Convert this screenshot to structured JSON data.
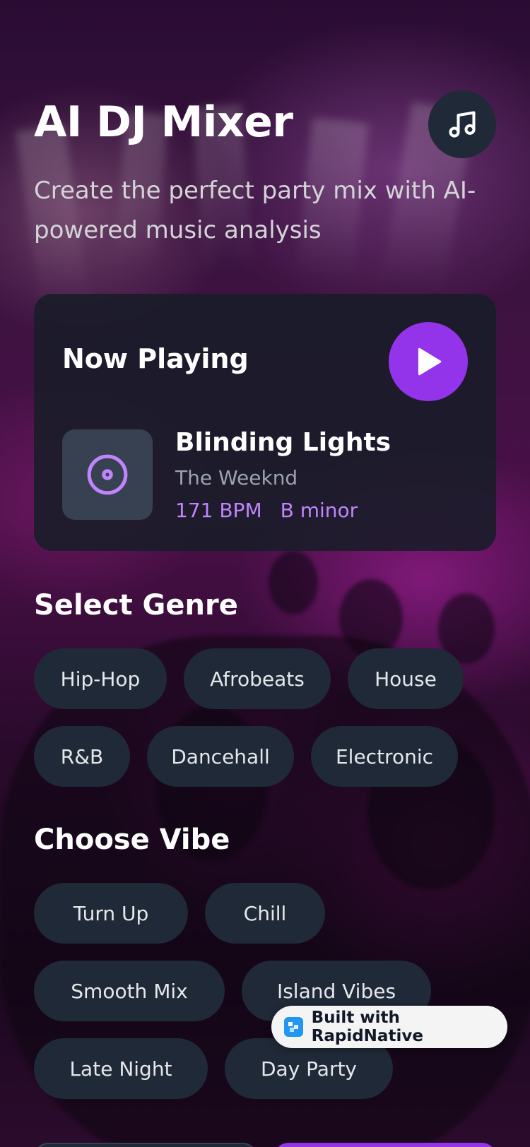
{
  "header": {
    "title": "AI DJ Mixer",
    "subtitle": "Create the perfect party mix with AI-powered music analysis",
    "music_icon": "music-note-icon"
  },
  "now_playing": {
    "heading": "Now Playing",
    "play_icon": "play-icon",
    "art_icon": "disc-icon",
    "track": "Blinding Lights",
    "artist": "The Weeknd",
    "bpm": "171 BPM",
    "key": "B minor"
  },
  "genre": {
    "heading": "Select Genre",
    "options": [
      "Hip-Hop",
      "Afrobeats",
      "House",
      "R&B",
      "Dancehall",
      "Electronic"
    ]
  },
  "vibe": {
    "heading": "Choose Vibe",
    "options": [
      "Turn Up",
      "Chill",
      "Smooth Mix",
      "Island Vibes",
      "Late Night",
      "Day Party"
    ]
  },
  "badge": {
    "label": "Built with RapidNative"
  },
  "colors": {
    "accent": "#9333ea",
    "accent_text": "#c084fc",
    "card": "#1f2937"
  }
}
